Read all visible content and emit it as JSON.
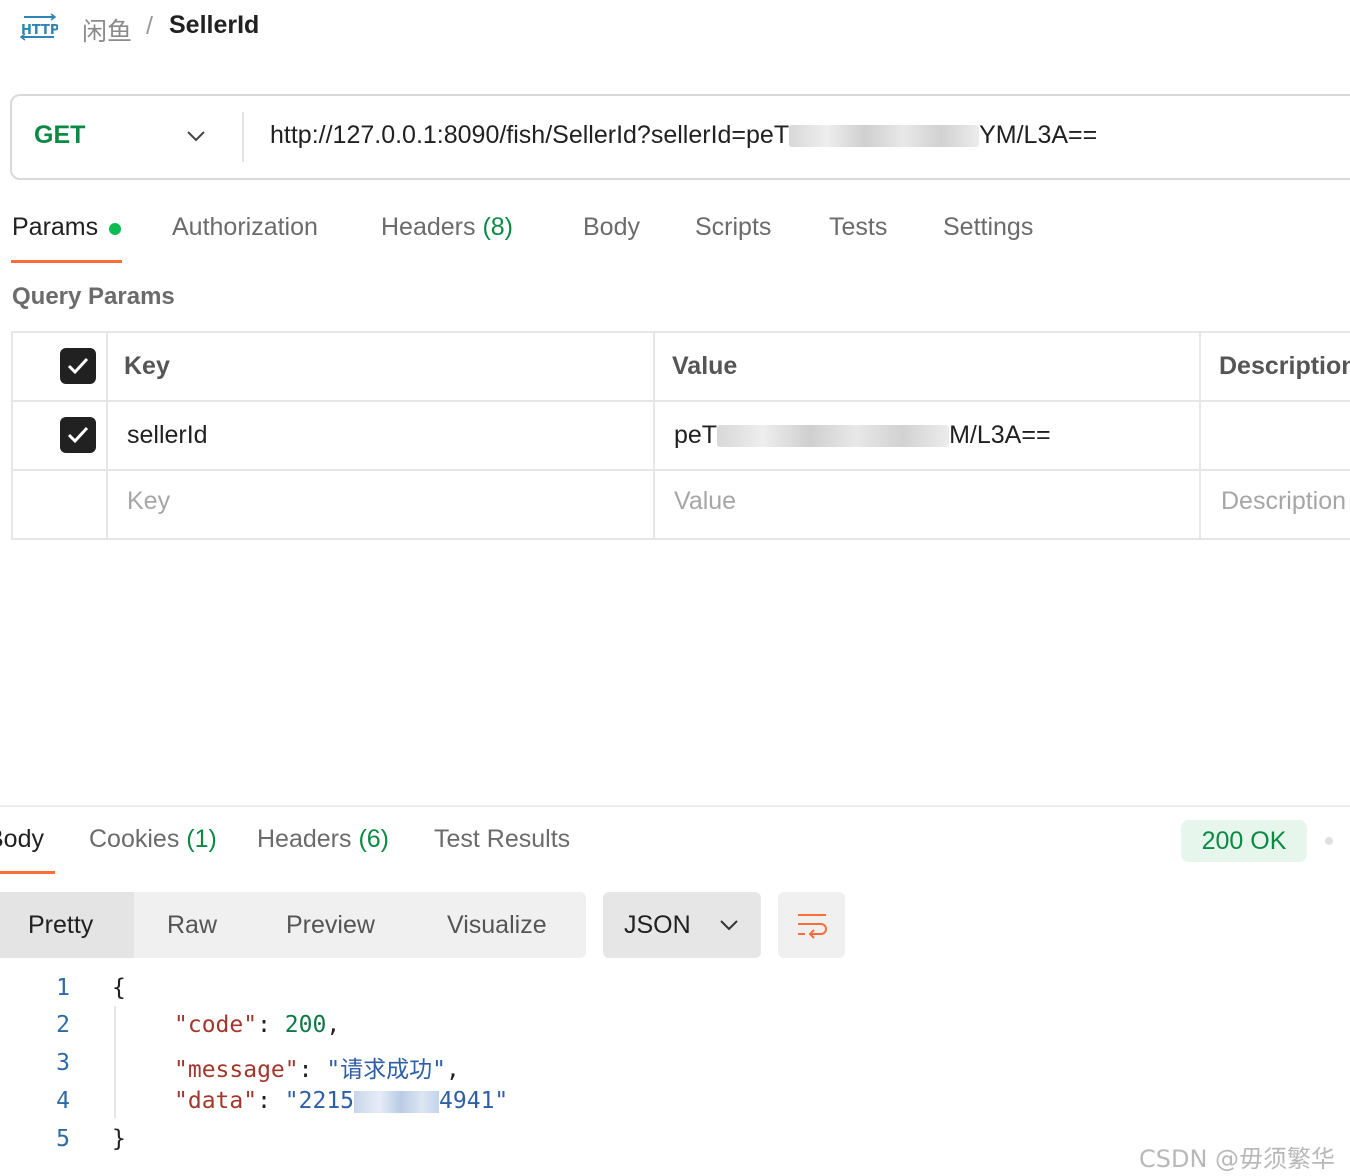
{
  "breadcrumb": {
    "icon": "http-icon",
    "icon_text": "HTTP",
    "parent": "闲鱼",
    "separator": "/",
    "current": "SellerId"
  },
  "request": {
    "method": "GET",
    "url_visible_prefix": "http://127.0.0.1:8090/fish/SellerId?sellerId=peT",
    "url_visible_suffix": "YM/L3A=="
  },
  "request_tabs": [
    {
      "label": "Params"
    },
    {
      "label": "Authorization"
    },
    {
      "label": "Headers",
      "count": "(8)"
    },
    {
      "label": "Body"
    },
    {
      "label": "Scripts"
    },
    {
      "label": "Tests"
    },
    {
      "label": "Settings"
    }
  ],
  "query_params": {
    "title": "Query Params",
    "headers": {
      "key": "Key",
      "value": "Value",
      "description": "Description"
    },
    "rows": [
      {
        "checked": true,
        "key": "sellerId",
        "value_prefix": "peT",
        "value_suffix": "M/L3A=="
      }
    ],
    "placeholders": {
      "key": "Key",
      "value": "Value",
      "description": "Description"
    }
  },
  "response": {
    "tabs": [
      {
        "label": "Body"
      },
      {
        "label": "Cookies",
        "count": "(1)"
      },
      {
        "label": "Headers",
        "count": "(6)"
      },
      {
        "label": "Test Results"
      }
    ],
    "status": "200 OK",
    "view_modes": [
      "Pretty",
      "Raw",
      "Preview",
      "Visualize"
    ],
    "format": "JSON",
    "line_numbers": [
      "1",
      "2",
      "3",
      "4",
      "5"
    ],
    "body": {
      "open": "{",
      "close": "}",
      "code_key": "\"code\"",
      "code_value": "200",
      "message_key": "\"message\"",
      "message_value": "\"请求成功\"",
      "data_key": "\"data\"",
      "data_value_prefix": "\"2215",
      "data_value_suffix": "4941\""
    }
  },
  "watermark": "CSDN @毋须繁华",
  "colors": {
    "accent": "#ff6c37",
    "method_get": "#0c8a44",
    "status_ok_bg": "#e6f6ec",
    "dot_green": "#0cbb52"
  }
}
